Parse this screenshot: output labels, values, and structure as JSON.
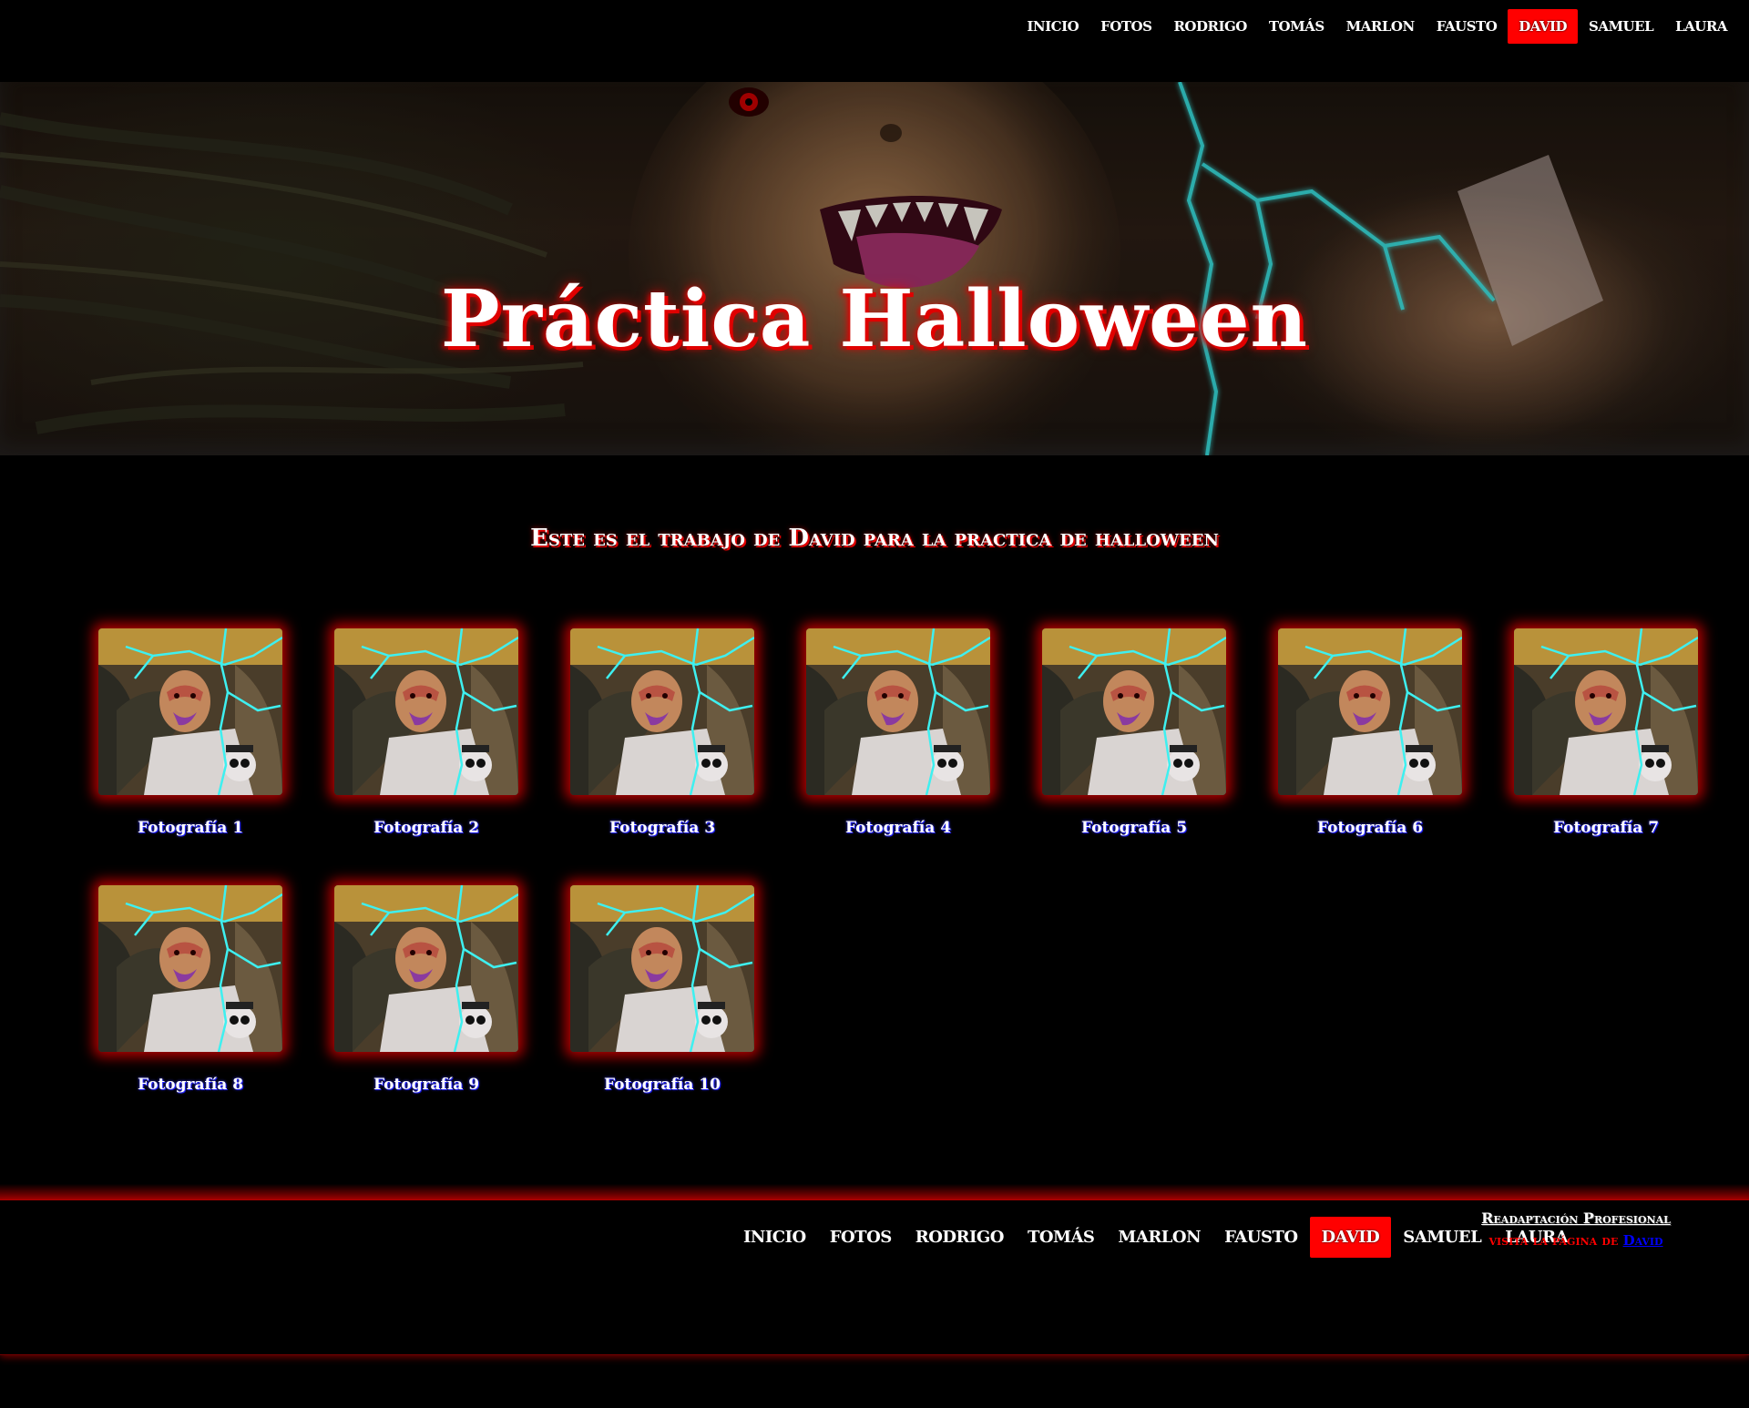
{
  "nav": {
    "items": [
      {
        "label": "INICIO",
        "active": false
      },
      {
        "label": "FOTOS",
        "active": false
      },
      {
        "label": "RODRIGO",
        "active": false
      },
      {
        "label": "TOMÁS",
        "active": false
      },
      {
        "label": "MARLON",
        "active": false
      },
      {
        "label": "FAUSTO",
        "active": false
      },
      {
        "label": "DAVID",
        "active": true
      },
      {
        "label": "SAMUEL",
        "active": false
      },
      {
        "label": "LAURA",
        "active": false
      }
    ]
  },
  "hero": {
    "title": "Práctica Halloween"
  },
  "main": {
    "subtitle": "Este es el trabajo de David para la practica de halloween"
  },
  "gallery": {
    "items": [
      {
        "caption": "Fotografía 1"
      },
      {
        "caption": "Fotografía 2"
      },
      {
        "caption": "Fotografía 3"
      },
      {
        "caption": "Fotografía 4"
      },
      {
        "caption": "Fotografía 5"
      },
      {
        "caption": "Fotografía 6"
      },
      {
        "caption": "Fotografía 7"
      },
      {
        "caption": "Fotografía 8"
      },
      {
        "caption": "Fotografía 9"
      },
      {
        "caption": "Fotografía 10"
      }
    ]
  },
  "footer": {
    "nav": [
      {
        "label": "INICIO",
        "active": false
      },
      {
        "label": "FOTOS",
        "active": false
      },
      {
        "label": "RODRIGO",
        "active": false
      },
      {
        "label": "TOMÁS",
        "active": false
      },
      {
        "label": "MARLON",
        "active": false
      },
      {
        "label": "FAUSTO",
        "active": false
      },
      {
        "label": "DAVID",
        "active": true
      },
      {
        "label": "SAMUEL",
        "active": false
      },
      {
        "label": "LAURA",
        "active": false
      }
    ],
    "info_title": "Readaptación Profesional",
    "info_prefix": "visita la página de",
    "info_link": "David"
  },
  "colors": {
    "accent": "#ff0000",
    "background": "#000000",
    "caption_shadow": "#1e1eff",
    "link": "#0000ff"
  },
  "icons": {
    "hero_image": "halloween-vampire-face-image",
    "thumbnail_image": "halloween-portrait-thumbnail-image"
  }
}
